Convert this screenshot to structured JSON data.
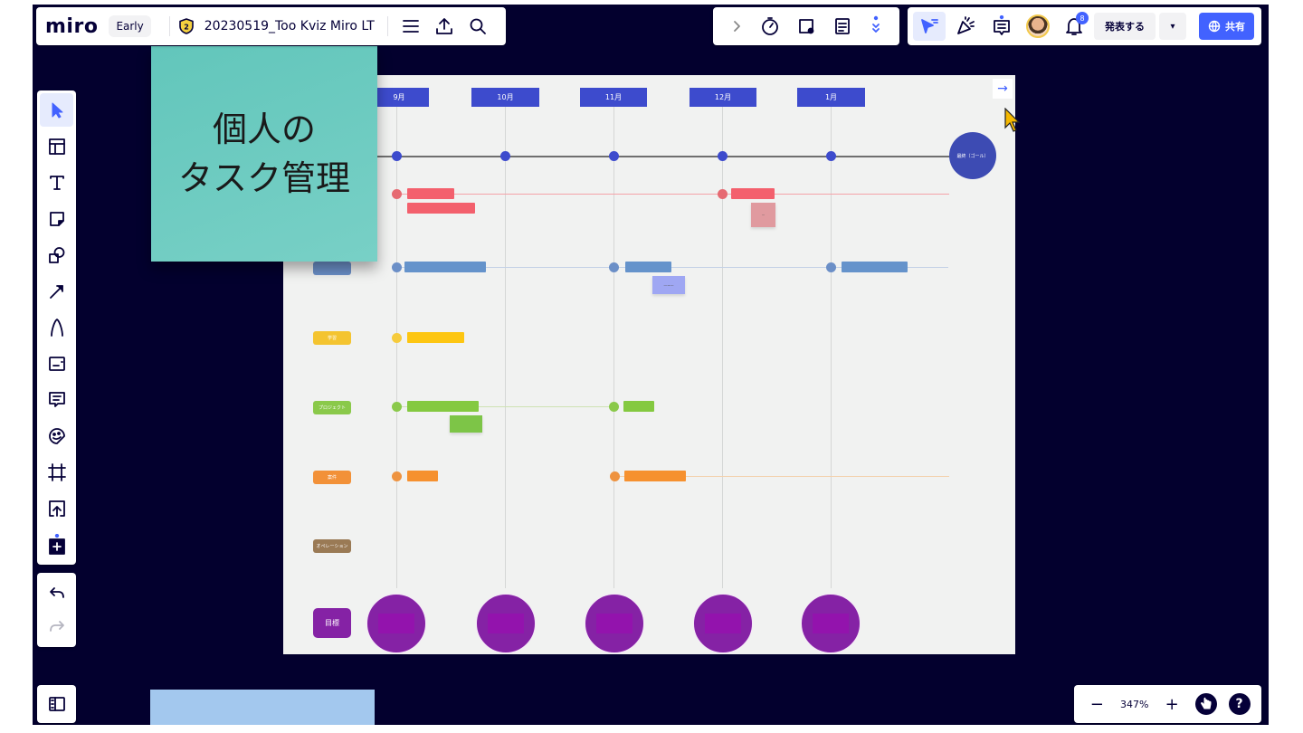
{
  "header": {
    "logo": "miro",
    "plan_badge": "Early",
    "board_badge_number": "2",
    "board_title": "20230519_Too Kviz Miro LT",
    "menu_icon": "hamburger-icon",
    "export_icon": "upload-icon",
    "search_icon": "search-icon"
  },
  "collab_toolbar": {
    "items": [
      "chevron-right-icon",
      "timer-icon",
      "sticky-note-add-icon",
      "notes-icon",
      "more-apps-icon"
    ]
  },
  "right_toolbar": {
    "items": [
      "reactions-filter-icon",
      "celebrate-icon",
      "comments-icon"
    ],
    "notifications_count": "8",
    "present_label": "発表する",
    "share_label": "共有"
  },
  "left_toolbar": {
    "tools": [
      {
        "name": "select",
        "icon": "cursor-icon",
        "active": true
      },
      {
        "name": "templates",
        "icon": "template-icon"
      },
      {
        "name": "text",
        "icon": "text-icon"
      },
      {
        "name": "sticky-note",
        "icon": "sticky-note-icon"
      },
      {
        "name": "shapes",
        "icon": "shapes-icon"
      },
      {
        "name": "connection-line",
        "icon": "arrow-icon"
      },
      {
        "name": "pen",
        "icon": "pen-icon"
      },
      {
        "name": "card",
        "icon": "card-icon"
      },
      {
        "name": "comment",
        "icon": "comment-icon"
      },
      {
        "name": "sticker",
        "icon": "sticker-icon"
      },
      {
        "name": "frame",
        "icon": "frame-icon"
      },
      {
        "name": "upload",
        "icon": "upload-icon"
      },
      {
        "name": "more-apps",
        "icon": "add-apps-icon"
      }
    ],
    "undo_icon": "undo-icon",
    "redo_icon": "redo-icon"
  },
  "zoom": {
    "level": "347%",
    "minus": "−",
    "plus": "+",
    "help": "?"
  },
  "canvas": {
    "big_sticky": "個人の\nタスク管理",
    "months": [
      "9月",
      "10月",
      "11月",
      "12月",
      "1月"
    ],
    "goal_circle_label": "最終（ゴール）",
    "row_labels": [
      {
        "text": "",
        "color": "#6b8fc7"
      },
      {
        "text": "学習",
        "color": "#f4c430"
      },
      {
        "text": "プロジェクト",
        "color": "#8ac94a"
      },
      {
        "text": "案件",
        "color": "#f29138"
      },
      {
        "text": "オペレーション",
        "color": "#9a7a55"
      }
    ],
    "goal_row_label": "目標",
    "colors": {
      "month_header": "#3d4bcd",
      "timeline_dot": "#3d4bcd",
      "red": "#f3606d",
      "blue": "#6593cb",
      "yellow": "#fdc612",
      "green": "#84c940",
      "orange": "#f6912f",
      "purple": "#8522a5"
    }
  }
}
